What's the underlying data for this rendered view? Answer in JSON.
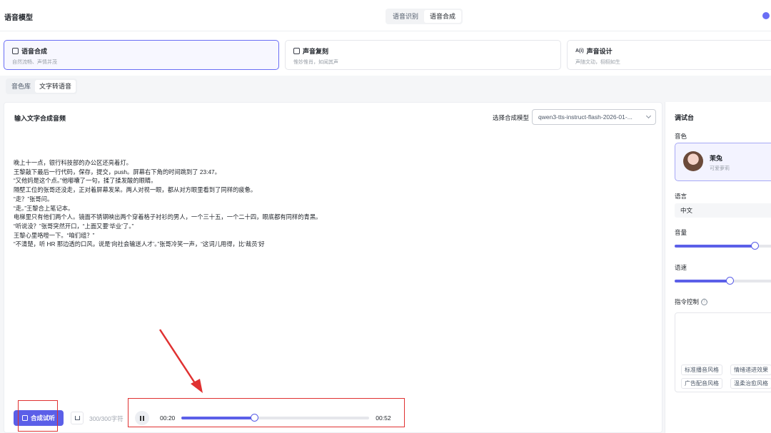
{
  "header": {
    "title": "语音模型",
    "tabs": [
      {
        "label": "语音识别"
      },
      {
        "label": "语音合成"
      }
    ]
  },
  "modes": [
    {
      "title": "语音合成",
      "subtitle": "自然流畅、声情并茂"
    },
    {
      "title": "声音复刻",
      "subtitle": "惟妙惟肖，如闻其声"
    },
    {
      "title": "声音设计",
      "icon_text": "A(i)",
      "subtitle": "声随文动，栩栩如生"
    }
  ],
  "subtabs": [
    {
      "label": "音色库"
    },
    {
      "label": "文字转语音"
    }
  ],
  "editor": {
    "title": "输入文字合成音频",
    "model_label": "选择合成模型",
    "model_value": "qwen3-tts-instruct-flash-2026-01-...",
    "lines": [
      "晚上十一点，银行科技部的办公区还亮着灯。",
      "王黎敲下最后一行代码，保存，提交，push。屏幕右下角的时间跳到了 23:47。",
      "“又他妈是这个点。”他嘟囔了一句，揉了揉发酸的眼睛。",
      "隔壁工位的张哥还没走，正对着屏幕发呆。两人对视一眼，都从对方眼里看到了同样的疲惫。",
      "“走？”张哥问。",
      "“走。”王黎合上笔记本。",
      "电梯里只有他们两个人。镜面不锈钢映出两个穿着格子衬衫的男人，一个三十五，一个二十四，眼底都有同样的青黑。",
      "“听说没？”张哥突然开口，“上面又要‘毕业’了。”",
      "王黎心里咯噔一下。“咱们组？”",
      "“不清楚，听 HR 那边透的口风，说是‘向社会输送人才’。”张哥冷笑一声，“这词儿用得，比‘裁员’好"
    ],
    "synth_label": "合成试听",
    "char_count": "300/300字符"
  },
  "player": {
    "current": "00:20",
    "duration": "00:52",
    "progress": 0.385
  },
  "debug": {
    "title": "调试台",
    "voice_label": "音色",
    "voice_name": "茉兔",
    "voice_desc": "可爱萝莉",
    "language_label": "语言",
    "language_value": "中文",
    "volume_label": "音量",
    "volume_value": 0.8,
    "speed_label": "语速",
    "speed_value": 0.55,
    "instruction_label": "指令控制",
    "info_icon": "ⓘ",
    "chips": [
      "标准播音风格",
      "情绪递进效果",
      "广告配音风格",
      "温柔治愈风格"
    ]
  },
  "colors": {
    "accent": "#5b5fe8",
    "annotation": "#e03131"
  }
}
